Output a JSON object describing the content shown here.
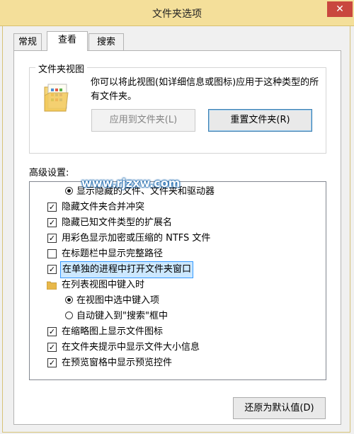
{
  "window": {
    "title": "文件夹选项",
    "close_glyph": "✕"
  },
  "tabs": [
    "常规",
    "查看",
    "搜索"
  ],
  "folder_views": {
    "heading": "文件夹视图",
    "description": "你可以将此视图(如详细信息或图标)应用于这种类型的所有文件夹。",
    "apply_button": "应用到文件夹(L)",
    "reset_button": "重置文件夹(R)"
  },
  "advanced": {
    "heading": "高级设置:",
    "items": [
      {
        "kind": "radio",
        "checked": true,
        "text": "显示隐藏的文件、文件夹和驱动器"
      },
      {
        "kind": "checkbox",
        "checked": true,
        "text": "隐藏文件夹合并冲突"
      },
      {
        "kind": "checkbox",
        "checked": true,
        "text": "隐藏已知文件类型的扩展名"
      },
      {
        "kind": "checkbox",
        "checked": true,
        "text": "用彩色显示加密或压缩的 NTFS 文件"
      },
      {
        "kind": "checkbox",
        "checked": false,
        "text": "在标题栏中显示完整路径"
      },
      {
        "kind": "checkbox",
        "checked": true,
        "text": "在单独的进程中打开文件夹窗口",
        "selected": true
      },
      {
        "kind": "folder",
        "text": "在列表视图中键入时"
      },
      {
        "kind": "radio",
        "checked": true,
        "text": "在视图中选中键入项"
      },
      {
        "kind": "radio",
        "checked": false,
        "text": "自动键入到\"搜索\"框中"
      },
      {
        "kind": "checkbox",
        "checked": true,
        "text": "在缩略图上显示文件图标"
      },
      {
        "kind": "checkbox",
        "checked": true,
        "text": "在文件夹提示中显示文件大小信息"
      },
      {
        "kind": "checkbox",
        "checked": true,
        "text": "在预览窗格中显示预览控件"
      }
    ]
  },
  "restore_defaults_button": "还原为默认值(D)",
  "watermark": "www.rjzxw.com",
  "scroll": {
    "up_glyph": "▲",
    "down_glyph": "▼"
  },
  "colors": {
    "titlebar": "#f4df9a",
    "close": "#c9473e",
    "selection": "#cce8ff"
  }
}
